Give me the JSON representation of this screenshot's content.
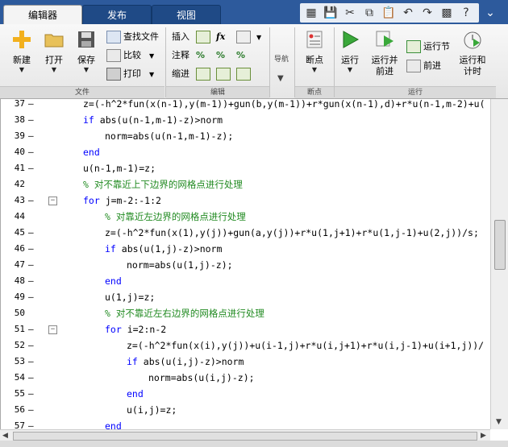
{
  "tabs": [
    {
      "label": "编辑器"
    },
    {
      "label": "发布"
    },
    {
      "label": "视图"
    }
  ],
  "ribbon": {
    "file_group": {
      "label": "文件",
      "new": "新建",
      "open": "打开",
      "save": "保存",
      "find_files": "查找文件",
      "compare": "比较",
      "print": "打印"
    },
    "edit_group": {
      "label": "编辑",
      "insert": "插入",
      "comment": "注释",
      "indent": "缩进",
      "fx": "fx"
    },
    "nav_group": {
      "label": "导航"
    },
    "breakpoints_group": {
      "label": "断点",
      "breakpoints": "断点"
    },
    "run_group": {
      "label": "运行",
      "run": "运行",
      "run_advance": "运行并\n前进",
      "run_section": "运行节",
      "advance": "前进",
      "run_time": "运行和\n计时"
    }
  },
  "editor": {
    "lines": [
      {
        "n": "37",
        "m": "—",
        "indent": 1,
        "parts": [
          {
            "t": "z=(-h^2*fun(x(n-1),y(m-1))+gun(b,y(m-1))+r*gun(x(n-1),d)+r*u(n-1,m-2)+u(",
            "c": "tx"
          }
        ]
      },
      {
        "n": "38",
        "m": "—",
        "indent": 1,
        "parts": [
          {
            "t": "if",
            "c": "kw"
          },
          {
            "t": " abs(u(n-1,m-1)-z)>norm",
            "c": "tx"
          }
        ]
      },
      {
        "n": "39",
        "m": "—",
        "indent": 2,
        "parts": [
          {
            "t": "norm=abs(u(n-1,m-1)-z);",
            "c": "tx"
          }
        ]
      },
      {
        "n": "40",
        "m": "—",
        "indent": 1,
        "parts": [
          {
            "t": "end",
            "c": "kw"
          }
        ]
      },
      {
        "n": "41",
        "m": "—",
        "indent": 1,
        "parts": [
          {
            "t": "u(n-1,m-1)=z;",
            "c": "tx"
          }
        ]
      },
      {
        "n": "42",
        "m": "",
        "indent": 1,
        "parts": [
          {
            "t": "% 对不靠近上下边界的网格点进行处理",
            "c": "cm"
          }
        ]
      },
      {
        "n": "43",
        "m": "—",
        "fold": true,
        "indent": 1,
        "parts": [
          {
            "t": "for",
            "c": "kw"
          },
          {
            "t": " j=m-2:-1:2",
            "c": "tx"
          }
        ]
      },
      {
        "n": "44",
        "m": "",
        "indent": 2,
        "parts": [
          {
            "t": "% 对靠近左边界的网格点进行处理",
            "c": "cm"
          }
        ]
      },
      {
        "n": "45",
        "m": "—",
        "indent": 2,
        "parts": [
          {
            "t": "z=(-h^2*fun(x(1),y(j))+gun(a,y(j))+r*u(1,j+1)+r*u(1,j-1)+u(2,j))/s;",
            "c": "tx"
          }
        ]
      },
      {
        "n": "46",
        "m": "—",
        "indent": 2,
        "parts": [
          {
            "t": "if",
            "c": "kw"
          },
          {
            "t": " abs(u(1,j)-z)>norm",
            "c": "tx"
          }
        ]
      },
      {
        "n": "47",
        "m": "—",
        "indent": 3,
        "parts": [
          {
            "t": "norm=abs(u(1,j)-z);",
            "c": "tx"
          }
        ]
      },
      {
        "n": "48",
        "m": "—",
        "indent": 2,
        "parts": [
          {
            "t": "end",
            "c": "kw"
          }
        ]
      },
      {
        "n": "49",
        "m": "—",
        "indent": 2,
        "parts": [
          {
            "t": "u(1,j)=z;",
            "c": "tx"
          }
        ]
      },
      {
        "n": "50",
        "m": "",
        "indent": 2,
        "parts": [
          {
            "t": "% 对不靠近左右边界的网格点进行处理",
            "c": "cm"
          }
        ]
      },
      {
        "n": "51",
        "m": "—",
        "fold": true,
        "indent": 2,
        "parts": [
          {
            "t": "for",
            "c": "kw"
          },
          {
            "t": " i=2:n-2",
            "c": "tx"
          }
        ]
      },
      {
        "n": "52",
        "m": "—",
        "indent": 3,
        "parts": [
          {
            "t": "z=(-h^2*fun(x(i),y(j))+u(i-1,j)+r*u(i,j+1)+r*u(i,j-1)+u(i+1,j))/",
            "c": "tx"
          }
        ]
      },
      {
        "n": "53",
        "m": "—",
        "indent": 3,
        "parts": [
          {
            "t": "if",
            "c": "kw"
          },
          {
            "t": " abs(u(i,j)-z)>norm",
            "c": "tx"
          }
        ]
      },
      {
        "n": "54",
        "m": "—",
        "indent": 4,
        "parts": [
          {
            "t": "norm=abs(u(i,j)-z);",
            "c": "tx"
          }
        ]
      },
      {
        "n": "55",
        "m": "—",
        "indent": 3,
        "parts": [
          {
            "t": "end",
            "c": "kw"
          }
        ]
      },
      {
        "n": "56",
        "m": "—",
        "indent": 3,
        "parts": [
          {
            "t": "u(i,j)=z;",
            "c": "tx"
          }
        ]
      },
      {
        "n": "57",
        "m": "—",
        "indent": 2,
        "parts": [
          {
            "t": "end",
            "c": "kw"
          }
        ]
      }
    ]
  }
}
